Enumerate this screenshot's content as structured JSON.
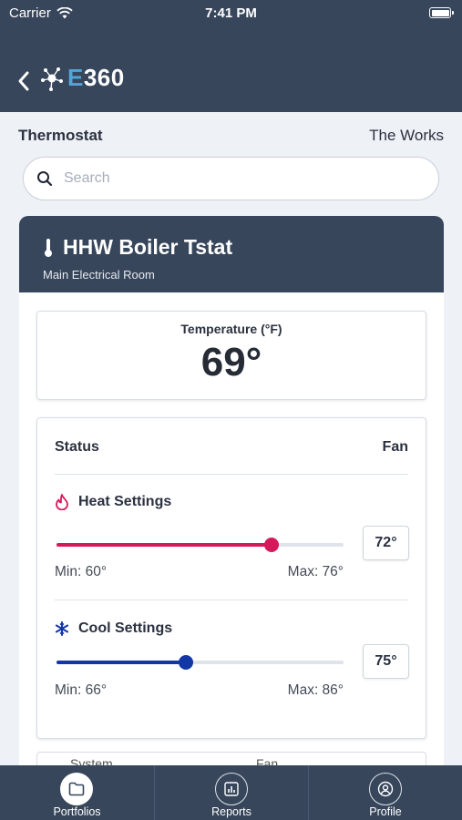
{
  "status_bar": {
    "carrier": "Carrier",
    "time": "7:41 PM"
  },
  "header": {
    "logo_letter": "E",
    "logo_rest": "360"
  },
  "breadcrumb": {
    "left": "Thermostat",
    "right": "The Works"
  },
  "search": {
    "placeholder": "Search",
    "value": ""
  },
  "device": {
    "name": "HHW Boiler Tstat",
    "location": "Main Electrical Room"
  },
  "temperature": {
    "label": "Temperature (°F)",
    "value": "69°"
  },
  "settings": {
    "status_label": "Status",
    "fan_label": "Fan",
    "heat": {
      "title": "Heat Settings",
      "min_label": "Min: 60°",
      "max_label": "Max: 76°",
      "value_label": "72°",
      "min": 60,
      "max": 76,
      "value": 72,
      "color": "#d6195a"
    },
    "cool": {
      "title": "Cool Settings",
      "min_label": "Min: 66°",
      "max_label": "Max: 86°",
      "value_label": "75°",
      "min": 66,
      "max": 86,
      "value": 75,
      "color": "#1237a6"
    }
  },
  "peek_row": {
    "left": "System",
    "right": "Fan"
  },
  "tabs": [
    {
      "label": "Portfolios",
      "icon": "folder-icon",
      "active": true
    },
    {
      "label": "Reports",
      "icon": "bar-chart-icon",
      "active": false
    },
    {
      "label": "Profile",
      "icon": "user-circle-icon",
      "active": false
    }
  ]
}
